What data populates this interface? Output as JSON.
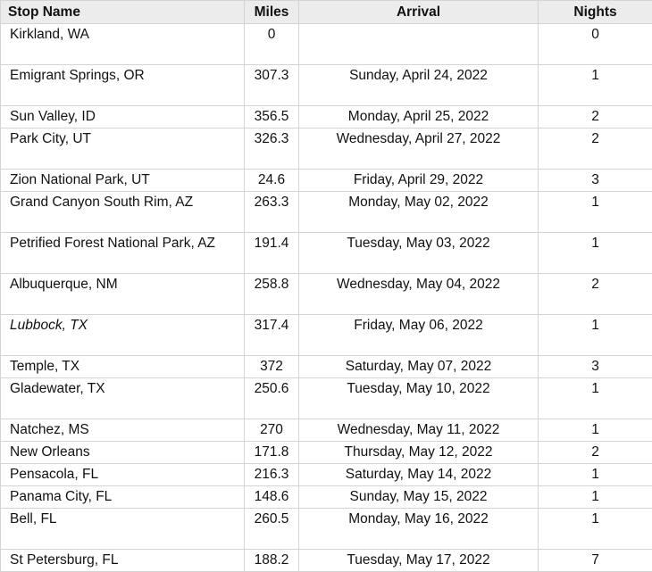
{
  "headers": {
    "stop_name": "Stop Name",
    "miles": "Miles",
    "arrival": "Arrival",
    "nights": "Nights"
  },
  "rows": [
    {
      "stop": "Kirkland, WA",
      "miles": "0",
      "arrival": "",
      "nights": "0"
    },
    {
      "stop": "Emigrant Springs, OR",
      "miles": "307.3",
      "arrival": "Sunday, April 24, 2022",
      "nights": "1"
    },
    {
      "stop": "Sun Valley, ID",
      "miles": "356.5",
      "arrival": "Monday, April 25, 2022",
      "nights": "2"
    },
    {
      "stop": "Park City, UT",
      "miles": "326.3",
      "arrival": "Wednesday, April 27, 2022",
      "nights": "2"
    },
    {
      "stop": "Zion National Park, UT",
      "miles": "24.6",
      "arrival": "Friday, April 29, 2022",
      "nights": "3"
    },
    {
      "stop": "Grand Canyon South Rim, AZ",
      "miles": "263.3",
      "arrival": "Monday, May 02, 2022",
      "nights": "1"
    },
    {
      "stop": "Petrified Forest National Park, AZ",
      "miles": "191.4",
      "arrival": "Tuesday, May 03, 2022",
      "nights": "1"
    },
    {
      "stop": "Albuquerque, NM",
      "miles": "258.8",
      "arrival": "Wednesday, May 04, 2022",
      "nights": "2"
    },
    {
      "stop": "Lubbock, TX",
      "miles": "317.4",
      "arrival": "Friday, May 06, 2022",
      "nights": "1"
    },
    {
      "stop": "Temple, TX",
      "miles": "372",
      "arrival": "Saturday, May 07, 2022",
      "nights": "3"
    },
    {
      "stop": "Gladewater, TX",
      "miles": "250.6",
      "arrival": "Tuesday, May 10, 2022",
      "nights": "1"
    },
    {
      "stop": "Natchez, MS",
      "miles": "270",
      "arrival": "Wednesday, May 11, 2022",
      "nights": "1"
    },
    {
      "stop": "New Orleans",
      "miles": "171.8",
      "arrival": "Thursday, May 12, 2022",
      "nights": "2"
    },
    {
      "stop": "Pensacola, FL",
      "miles": "216.3",
      "arrival": "Saturday, May 14, 2022",
      "nights": "1"
    },
    {
      "stop": "Panama City, FL",
      "miles": "148.6",
      "arrival": "Sunday, May 15, 2022",
      "nights": "1"
    },
    {
      "stop": "Bell, FL",
      "miles": "260.5",
      "arrival": "Monday, May 16, 2022",
      "nights": "1"
    },
    {
      "stop": "St Petersburg, FL",
      "miles": "188.2",
      "arrival": "Tuesday, May 17, 2022",
      "nights": "7"
    }
  ]
}
